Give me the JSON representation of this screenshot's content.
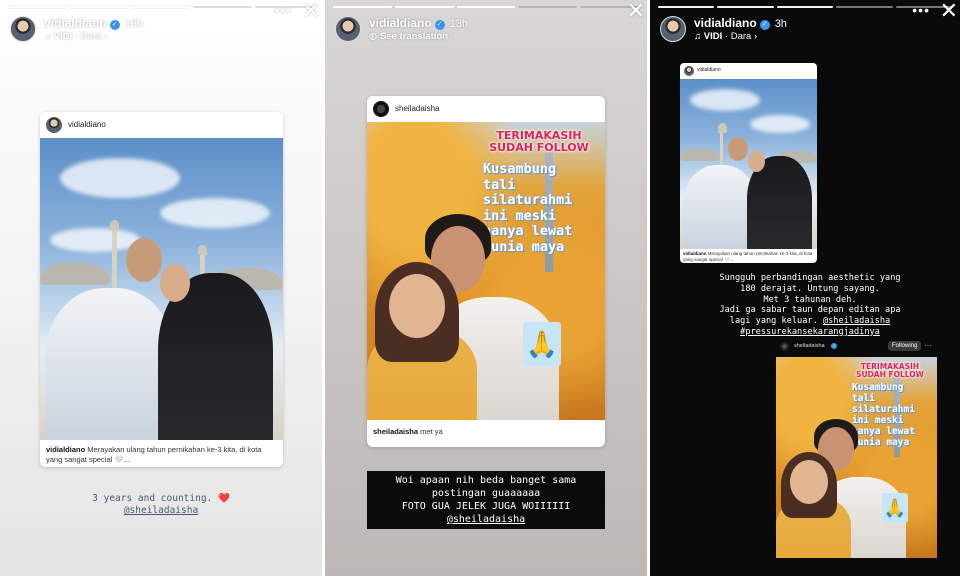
{
  "stories": [
    {
      "user": "vidialdiano",
      "time": "16h",
      "sub_left": "VIDI",
      "sub_sep": "·",
      "sub_right": "Dara",
      "sub_arrow": "›",
      "post_user": "vidialdiano",
      "caption_user": "vidialdiano",
      "caption_text": "Merayakan ulang tahun pernikahan ke-3 kita, di kota yang sangat special 🤍...",
      "text_line1": "3 years and counting.",
      "heart": "❤️",
      "mention": "@sheiladaisha"
    },
    {
      "user": "vidialdiano",
      "time": "13h",
      "sub_text": "See translation",
      "post_user": "sheiladaisha",
      "overlay_red": [
        "TERIMAKASIH",
        "SUDAH FOLLOW"
      ],
      "overlay_lines": [
        "Kusambung",
        "tali",
        "silaturahmi",
        "ini meski",
        "hanya lewat",
        "dunia maya"
      ],
      "praying_emoji": "🙏",
      "caption_user": "sheiladaisha",
      "caption_text": "met ya",
      "box_lines": [
        "Woi apaan nih beda banget sama",
        "postingan guaaaaaa",
        "FOTO GUA JELEK JUGA WOIIIIII"
      ],
      "box_mention": "@sheiladaisha"
    },
    {
      "user": "vidialdiano",
      "time": "3h",
      "sub_left": "VIDI",
      "sub_sep": "·",
      "sub_right": "Dara",
      "sub_arrow": "›",
      "post_user": "vidialdiano",
      "caption_user": "vidialdiano",
      "caption_text": "Merayakan ulang tahun pernikahan ke-3 kita, di kota yang sangat special 🤍...",
      "text_lines": [
        "Sungguh perbandingan aesthetic yang",
        "180 derajat. Untung sayang.",
        "Met 3 tahunan deh.",
        "Jadi ga sabar taun depan editan apa",
        "lagi yang keluar."
      ],
      "text_mention": "@sheiladaisha",
      "text_hashtag": "#pressurekansekarangjadinya",
      "reshare_user": "sheiladaisha",
      "follow_label": "Following",
      "reshare_more": "···"
    }
  ],
  "icons": {
    "more": "more-icon",
    "close": "close-icon",
    "verified": "verified-icon",
    "music": "music-icon",
    "translate": "translate-icon"
  },
  "colors": {
    "verified": "#3897f0",
    "heart": "#e33a3a",
    "overlay_red": "#e0205b"
  }
}
